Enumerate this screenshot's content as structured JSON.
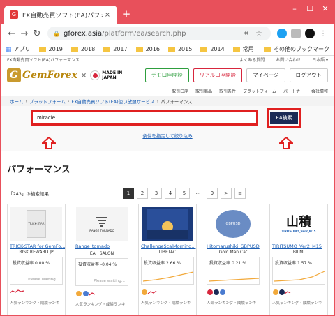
{
  "browser": {
    "tab_title": "FX自動売買ソフト(EA)パフォーマン",
    "tab_close": "×",
    "new_tab": "+",
    "win_min": "–",
    "win_max": "☐",
    "win_close": "✕",
    "url_host": "gforex.asia",
    "url_path": "/platform/ea/search.php",
    "bookmarks": [
      "アプリ",
      "2019",
      "2018",
      "2017",
      "2016",
      "2015",
      "2014",
      "常用",
      "その他のブックマーク"
    ]
  },
  "site": {
    "tagline": "FX自動売買ソフト(EA)パフォーマンス",
    "toplinks": [
      "よくある質問",
      "お問い合わせ",
      "日本語 ▾"
    ],
    "logo_text": "GemForex",
    "logo_times": "×",
    "made_in": "MADE IN",
    "japan": "JAPAN",
    "buttons": {
      "demo": "デモ口座開設",
      "real": "リアル口座開設",
      "mypage": "マイページ",
      "logout": "ログアウト"
    },
    "subnav": [
      "取引口座",
      "取引商品",
      "取引条件",
      "プラットフォーム",
      "パートナー",
      "会社情報"
    ],
    "breadcrumb": [
      "ホーム",
      "プラットフォーム",
      "FX自動売買ソフト(EA)使い放題サービス",
      "パフォーマンス"
    ]
  },
  "search": {
    "value": "miracle",
    "button": "EA検索",
    "narrow_link": "条件を指定して絞り込み"
  },
  "results": {
    "heading": "パフォーマンス",
    "count_text": "「243」の検索結果",
    "pages": [
      "1",
      "2",
      "3",
      "4",
      "5",
      "...",
      "9",
      ">",
      "≡"
    ],
    "rate_label": "投資収益率",
    "waiting": "Please waiting...",
    "cards": [
      {
        "name": "TRICK-STAR for GemFo...",
        "dev": "RISK REWARD JP",
        "rate": "0.00 %",
        "thumb": "TRICK-STAR",
        "has_line": false
      },
      {
        "name": "Range_tornado",
        "dev": "EA　SALON",
        "rate": "-0.04 %",
        "thumb": "RANGE TORNADO",
        "has_line": false
      },
      {
        "name": "ChallengeScalMorning...",
        "dev": "LIBETAC",
        "rate": "2.66 %",
        "thumb": "",
        "has_line": true
      },
      {
        "name": "Hitomarushiki_GBPUSD",
        "dev": "Gold Man Cat",
        "rate": "0.21 %",
        "thumb": "GBPUSD",
        "has_line": true
      },
      {
        "name": "TIRITSUMO_Ver2_M15",
        "dev": "BIIIMI",
        "rate": "1.57 %",
        "thumb": "TIRITSUMO_Ver2_M15",
        "has_line": true
      }
    ],
    "bottom_text": "人気ランキング・成績ランキ"
  }
}
